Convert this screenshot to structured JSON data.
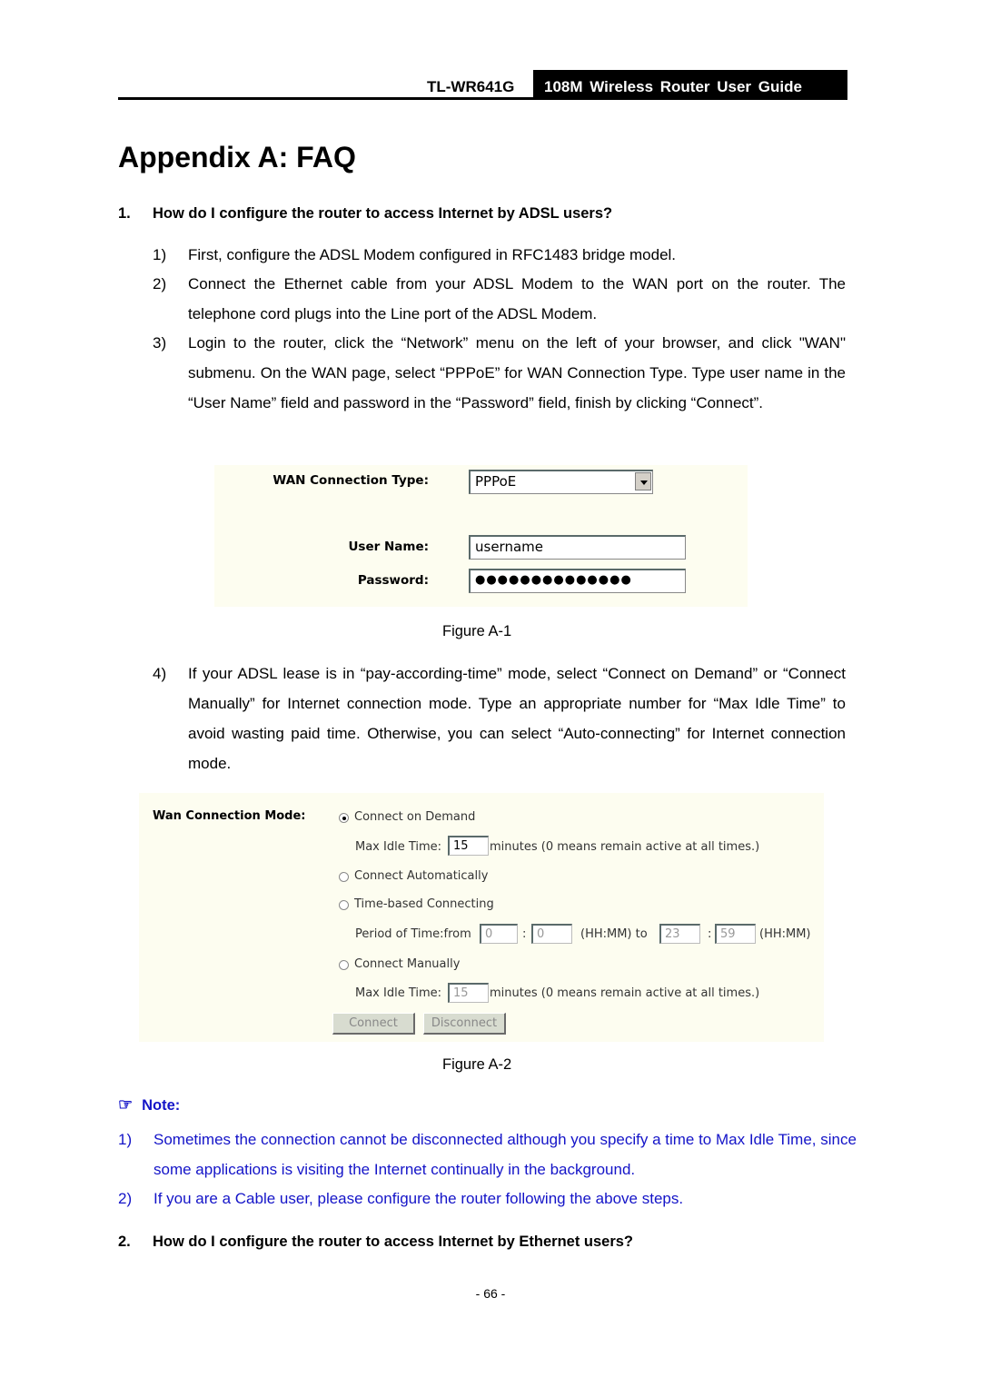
{
  "header": {
    "model": "TL-WR641G",
    "guide_title": "108M Wireless Router User Guide"
  },
  "page_title": "Appendix A: FAQ",
  "questions": [
    {
      "num": "1.",
      "text": "How do I configure the router to access Internet by ADSL users?"
    },
    {
      "num": "2.",
      "text": "How do I configure the router to access Internet by Ethernet users?"
    }
  ],
  "steps": [
    {
      "num": "1)",
      "text": "First, configure the ADSL Modem configured in RFC1483 bridge model."
    },
    {
      "num": "2)",
      "text": "Connect the Ethernet cable from your ADSL Modem to the WAN port on the router. The telephone cord plugs into the Line port of the ADSL Modem."
    },
    {
      "num": "3)",
      "text": "Login to the router, click the “Network” menu on the left of your browser, and click \"WAN\" submenu. On the WAN page, select “PPPoE” for WAN Connection Type. Type user name in the “User Name” field and password in the “Password” field, finish by clicking “Connect”."
    },
    {
      "num": "4)",
      "text": "If your ADSL lease is in “pay-according-time” mode, select “Connect on Demand” or “Connect Manually” for Internet connection mode. Type an appropriate number for “Max Idle Time” to avoid wasting paid time. Otherwise, you can select “Auto-connecting” for Internet connection mode."
    }
  ],
  "figure1": {
    "caption": "Figure A-1",
    "wan_type_label": "WAN Connection Type:",
    "wan_type_value": "PPPoE",
    "username_label": "User Name:",
    "username_value": "username",
    "password_label": "Password:",
    "password_value": "●●●●●●●●●●●●●●"
  },
  "figure2": {
    "caption": "Figure A-2",
    "mode_label": "Wan Connection Mode:",
    "opt_demand": "Connect on Demand",
    "opt_auto": "Connect Automatically",
    "opt_time": "Time-based Connecting",
    "opt_manual": "Connect Manually",
    "selected": "Connect on Demand",
    "max_idle_label": "Max Idle Time:",
    "max_idle_demand": "15",
    "max_idle_manual": "15",
    "minutes_note": "minutes (0 means remain active at all times.)",
    "period_label": "Period of Time:from",
    "from_hh": "0",
    "from_mm": "0",
    "colon": ":",
    "hhmm_to": "(HH:MM) to",
    "to_hh": "23",
    "to_mm": "59",
    "hhmm": "(HH:MM)",
    "connect_btn": "Connect",
    "disconnect_btn": "Disconnect"
  },
  "note": {
    "icon": "pointing-hand-icon",
    "heading": "Note:",
    "color": "#1414c8",
    "items": [
      {
        "num": "1)",
        "text": "Sometimes the connection cannot be disconnected although you specify a time to Max Idle Time, since some applications is visiting the Internet continually in the background."
      },
      {
        "num": "2)",
        "text": "If you are a Cable user, please configure the router following the above steps."
      }
    ]
  },
  "page_number": "- 66 -"
}
